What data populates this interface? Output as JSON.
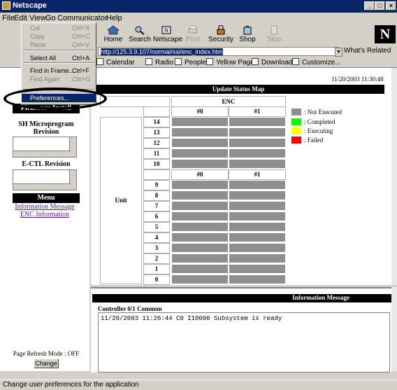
{
  "window": {
    "title": "Netscape"
  },
  "menubar": [
    "File",
    "Edit",
    "View",
    "Go",
    "Communicator",
    "Help"
  ],
  "toolbar": {
    "buttons": [
      {
        "label": "Home",
        "icon": "home-icon",
        "enabled": true
      },
      {
        "label": "Search",
        "icon": "search-icon",
        "enabled": true
      },
      {
        "label": "Netscape",
        "icon": "netscape-icon",
        "enabled": true
      },
      {
        "label": "Print",
        "icon": "print-icon",
        "enabled": false
      },
      {
        "label": "Security",
        "icon": "security-icon",
        "enabled": true
      },
      {
        "label": "Shop",
        "icon": "shop-icon",
        "enabled": true
      },
      {
        "label": "Stop",
        "icon": "stop-icon",
        "enabled": false
      }
    ],
    "logo": "N"
  },
  "location": {
    "url": "http://125.3.9.107/normal/ssi/enc_index.htm",
    "whats_related": "What's Related"
  },
  "personal_toolbar": [
    "Calendar",
    "Radio",
    "People",
    "Yellow Pages",
    "Download",
    "Customize..."
  ],
  "edit_menu": {
    "items": [
      {
        "label": "Cut",
        "shortcut": "Ctrl+X",
        "enabled": false
      },
      {
        "label": "Copy",
        "shortcut": "Ctrl+C",
        "enabled": false
      },
      {
        "label": "Paste",
        "shortcut": "Ctrl+V",
        "enabled": false
      },
      {
        "label": "Select All",
        "shortcut": "Ctrl+A",
        "enabled": true
      },
      {
        "label": "Find in Frame...",
        "shortcut": "Ctrl+F",
        "enabled": true
      },
      {
        "label": "Find Again",
        "shortcut": "Ctrl+G",
        "enabled": false
      },
      {
        "label": "Preferences...",
        "shortcut": "",
        "enabled": true,
        "highlighted": true
      }
    ]
  },
  "left_panel": {
    "firmware_install": "Firmware Install",
    "sh_microprogram_revision": "SH Microprogram Revision",
    "ectl_revision": "E-CTL Revision",
    "menu_header": "Menu",
    "links": [
      "Information Message",
      "ENC Information"
    ],
    "page_refresh_mode": "Page Refresh Mode : OFF",
    "change_button": "Change"
  },
  "datetime": "11/20/2003 11:30:48",
  "update_status_map": {
    "title": "Update Status Map",
    "enc_header": "ENC",
    "unit_label": "Unit",
    "columns": [
      "#0",
      "#1"
    ],
    "upper_units": [
      "14",
      "13",
      "12",
      "11",
      "10"
    ],
    "lower_units": [
      "9",
      "8",
      "7",
      "6",
      "5",
      "4",
      "3",
      "2",
      "1",
      "0"
    ],
    "status": "Not Executed"
  },
  "legend": [
    {
      "label": ": Not Executed",
      "color": "#8f8f8f"
    },
    {
      "label": ": Completed",
      "color": "#00ff00"
    },
    {
      "label": ": Executing",
      "color": "#ffff00"
    },
    {
      "label": ": Failed",
      "color": "#ff0000"
    }
  ],
  "information_message": {
    "header": "Information Message",
    "controller": "Controller 0/1 Common",
    "messages": [
      "11/20/2003 11:26:44 C0 I10000 Subsystem is ready"
    ]
  },
  "statusbar": "Change user preferences for the application"
}
